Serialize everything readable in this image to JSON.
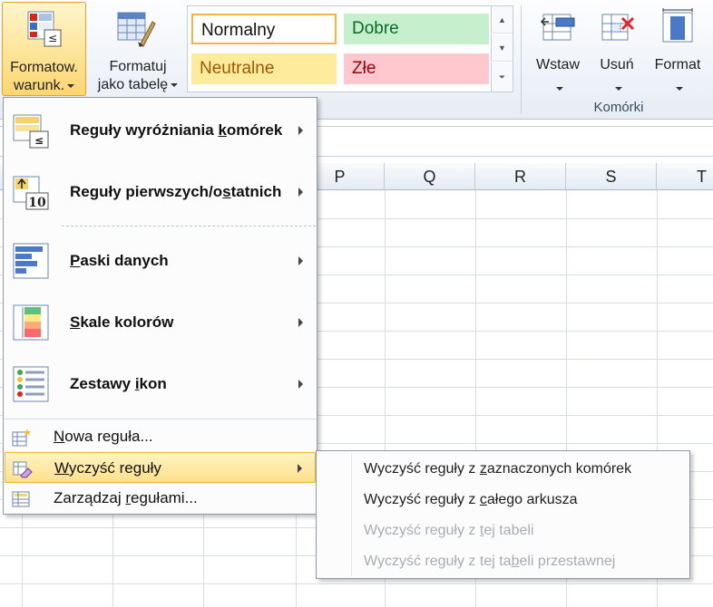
{
  "ribbon": {
    "conditional_formatting": {
      "line1": "Formatow.",
      "line2": "warunk."
    },
    "format_as_table": {
      "line1": "Formatuj",
      "line2": "jako tabelę"
    },
    "styles": {
      "normal": "Normalny",
      "good": "Dobre",
      "neutral": "Neutralne",
      "bad": "Złe"
    },
    "cells": {
      "insert": "Wstaw",
      "delete": "Usuń",
      "format": "Format",
      "group_label": "Komórki"
    }
  },
  "sheet": {
    "columns": [
      "P",
      "Q",
      "R",
      "S",
      "T"
    ]
  },
  "menu": {
    "items": [
      {
        "label_pre": "Reguły wyróżniania ",
        "label_u": "k",
        "label_post": "omórek"
      },
      {
        "label_pre": "Reguły pierwszych/o",
        "label_u": "s",
        "label_post": "tatnich"
      },
      {
        "label_pre": "",
        "label_u": "P",
        "label_post": "aski danych"
      },
      {
        "label_pre": "",
        "label_u": "S",
        "label_post": "kale kolorów"
      },
      {
        "label_pre": "Zestawy ",
        "label_u": "i",
        "label_post": "kon"
      }
    ],
    "new_rule": {
      "label_pre": "",
      "label_u": "N",
      "label_post": "owa reguła..."
    },
    "clear_rules": {
      "label_pre": "",
      "label_u": "W",
      "label_post": "yczyść reguły"
    },
    "manage_rules": {
      "label_pre": "Zarządzaj ",
      "label_u": "r",
      "label_post": "egułami..."
    }
  },
  "submenu": {
    "items": [
      {
        "pre": "Wyczyść reguły z ",
        "u": "z",
        "post": "aznaczonych komórek",
        "enabled": true
      },
      {
        "pre": "Wyczyść reguły z ",
        "u": "c",
        "post": "ałego arkusza",
        "enabled": true
      },
      {
        "pre": "Wyczyść reguły z ",
        "u": "t",
        "post": "ej tabeli",
        "enabled": false
      },
      {
        "pre": "Wyczyść reguły z tej ta",
        "u": "b",
        "post": "eli przestawnej",
        "enabled": false
      }
    ]
  }
}
